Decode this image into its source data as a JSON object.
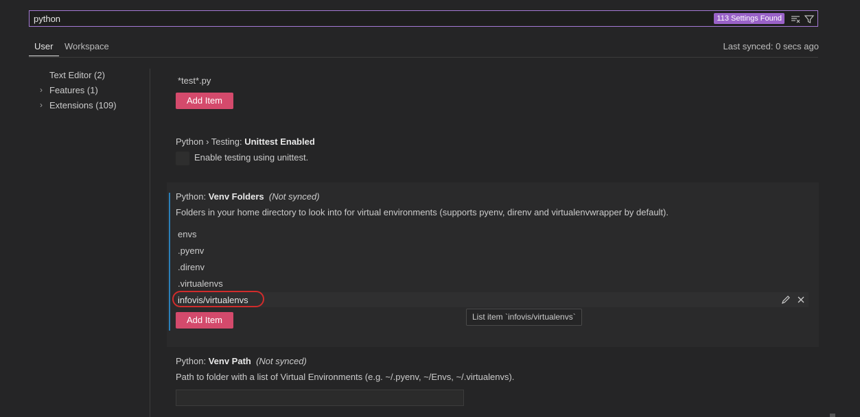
{
  "search": {
    "value": "python",
    "results_badge": "113 Settings Found"
  },
  "tabs": [
    {
      "label": "User"
    },
    {
      "label": "Workspace"
    }
  ],
  "sync_status": "Last synced: 0 secs ago",
  "toc": [
    {
      "label": "Text Editor (2)"
    },
    {
      "label": "Features (1)"
    },
    {
      "label": "Extensions (109)"
    }
  ],
  "settings": {
    "test_pattern_item": "*test*.py",
    "add_item_label": "Add Item",
    "unittest": {
      "category": "Python › Testing: ",
      "name": "Unittest Enabled",
      "description": "Enable testing using unittest."
    },
    "venv_folders": {
      "category": "Python: ",
      "name": "Venv Folders",
      "note": "(Not synced)",
      "description": "Folders in your home directory to look into for virtual environments (supports pyenv, direnv and virtualenvwrapper by default).",
      "items": [
        "envs",
        ".pyenv",
        ".direnv",
        ".virtualenvs",
        "infovis/virtualenvs"
      ],
      "tooltip": "List item `infovis/virtualenvs`"
    },
    "venv_path": {
      "category": "Python: ",
      "name": "Venv Path",
      "note": "(Not synced)",
      "description": "Path to folder with a list of Virtual Environments (e.g. ~/.pyenv, ~/Envs, ~/.virtualenvs).",
      "value": ""
    }
  },
  "colors": {
    "accent_button": "#d44a6c",
    "search_border": "#a57ad6",
    "badge": "#9a62c8",
    "focus_bar": "#2b7fb8",
    "annotation_circle": "#d22c2c"
  },
  "icons": [
    "clear-filter-icon",
    "filter-icon",
    "chevron-right-icon",
    "edit-icon",
    "close-icon"
  ]
}
